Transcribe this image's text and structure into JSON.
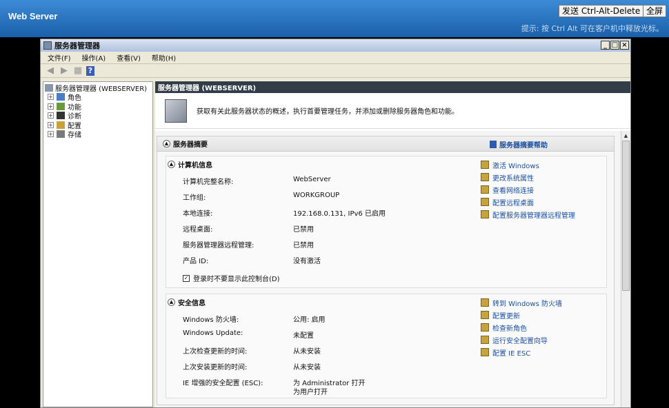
{
  "rdp": {
    "title": "Web Server",
    "send_cad": "发送 Ctrl-Alt-Delete",
    "fullscreen": "全屏",
    "hint": "提示: 按 Ctrl Alt 可在客户机中释放光标。"
  },
  "window": {
    "title": "服务器管理器",
    "menu": [
      "文件(F)",
      "操作(A)",
      "查看(V)",
      "帮助(H)"
    ]
  },
  "tree": {
    "root": "服务器管理器 (WEBSERVER)",
    "items": [
      "角色",
      "功能",
      "诊断",
      "配置",
      "存储"
    ]
  },
  "content": {
    "header": "服务器管理器 (WEBSERVER)",
    "intro": "获取有关此服务器状态的概述，执行首要管理任务，并添加或删除服务器角色和功能。",
    "summary_title": "服务器摘要",
    "summary_help": "服务器摘要帮助"
  },
  "computer_info": {
    "title": "计算机信息",
    "rows": [
      {
        "k": "计算机完整名称:",
        "v": "WebServer"
      },
      {
        "k": "工作组:",
        "v": "WORKGROUP"
      },
      {
        "k": "本地连接:",
        "v": "192.168.0.131, IPv6 已启用"
      },
      {
        "k": "远程桌面:",
        "v": "已禁用"
      },
      {
        "k": "服务器管理器远程管理:",
        "v": "已禁用"
      },
      {
        "k": "产品 ID:",
        "v": "没有激活"
      }
    ],
    "checkbox": "登录时不要显示此控制台(D)",
    "links": [
      "激活 Windows",
      "更改系统属性",
      "查看网络连接",
      "配置远程桌面",
      "配置服务器管理器远程管理"
    ]
  },
  "security_info": {
    "title": "安全信息",
    "rows": [
      {
        "k": "Windows 防火墙:",
        "v": "公用: 启用"
      },
      {
        "k": "Windows Update:",
        "v": "未配置"
      },
      {
        "k": "上次检查更新的时间:",
        "v": "从未安装"
      },
      {
        "k": "上次安装更新的时间:",
        "v": "从未安装"
      },
      {
        "k": "IE 增强的安全配置 (ESC):",
        "v": "为 Administrator 打开"
      },
      {
        "k": "",
        "v": "为用户打开"
      }
    ],
    "links": [
      "转到 Windows 防火墙",
      "配置更新",
      "检查新角色",
      "运行安全配置向导",
      "配置 IE ESC"
    ]
  }
}
